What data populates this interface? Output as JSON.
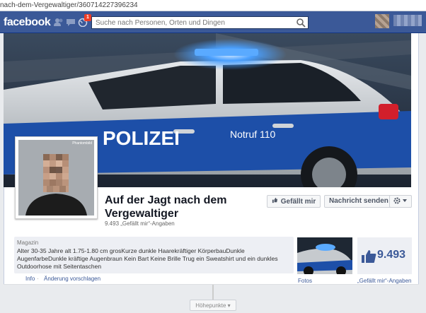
{
  "browser": {
    "url": "nach-dem-Vergewaltiger/360714227396234"
  },
  "topbar": {
    "logo": "facebook",
    "notification_count": "1",
    "search_placeholder": "Suche nach Personen, Orten und Dingen"
  },
  "cover": {
    "car_text_left": "POLIZEI",
    "car_text_right": "Notruf 110",
    "colors": {
      "car_blue": "#1d4fa8",
      "car_silver": "#c4c8cc",
      "siren": "#4aa0ff"
    }
  },
  "profile": {
    "pic_label": "Phantombild",
    "title": "Auf der Jagt nach dem Vergewaltiger",
    "likes_line": "9.493 „Gefällt mir“-Angaben"
  },
  "actions": {
    "like": "Gefällt mir",
    "message": "Nachricht senden",
    "settings_icon": "gear-icon"
  },
  "about": {
    "category": "Magazin",
    "description": "Alter 30-35 Jahre alt 1.75-1.80 cm grosKurze dunkle Haarekräftiger KörperbauDunkle AugenfarbeDunkle kräftige Augenbraun Kein Bart Keine Brille Trug ein Sweatshirt und ein dunkles Outdoorhose mit Seitentaschen",
    "info_link": "Info",
    "separator": "·",
    "edit_link": "Änderung vorschlagen"
  },
  "tiles": {
    "photos_label": "Fotos",
    "likes_number": "9.493",
    "likes_label": "„Gefällt mir“-Angaben"
  },
  "timeline": {
    "highlights": "Höhepunkte ▾"
  }
}
